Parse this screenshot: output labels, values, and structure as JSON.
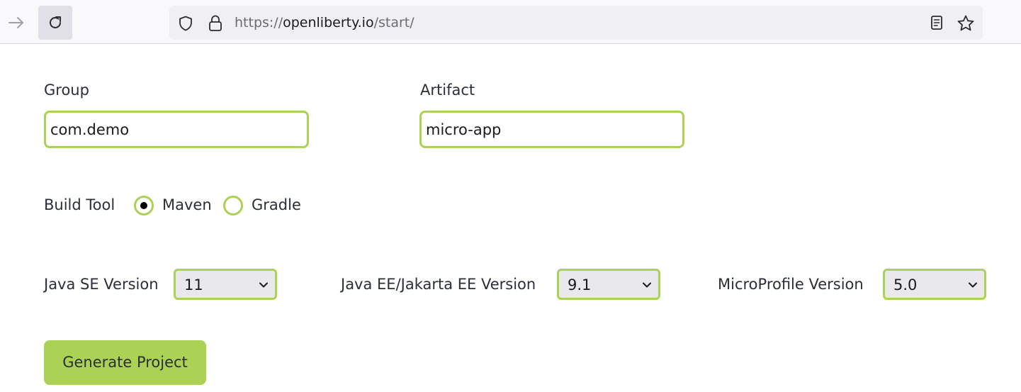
{
  "browser": {
    "url_scheme": "https://",
    "url_host": "openliberty.io",
    "url_path": "/start/",
    "icons": [
      "arrow-forward-icon",
      "reload-icon",
      "shield-icon",
      "lock-icon",
      "reader-view-icon",
      "star-icon"
    ]
  },
  "form": {
    "group_label": "Group",
    "group_value": "com.demo",
    "artifact_label": "Artifact",
    "artifact_value": "micro-app",
    "build_tool_label": "Build Tool",
    "build_tool_options": [
      {
        "label": "Maven",
        "selected": true
      },
      {
        "label": "Gradle",
        "selected": false
      }
    ],
    "java_se_label": "Java SE Version",
    "java_se_value": "11",
    "jakarta_ee_label": "Java EE/Jakarta EE Version",
    "jakarta_ee_value": "9.1",
    "microprofile_label": "MicroProfile Version",
    "microprofile_value": "5.0",
    "generate_label": "Generate Project"
  },
  "colors": {
    "accent": "#abd155",
    "text": "#2b2f3a",
    "select_bg": "#e9e9ed"
  }
}
